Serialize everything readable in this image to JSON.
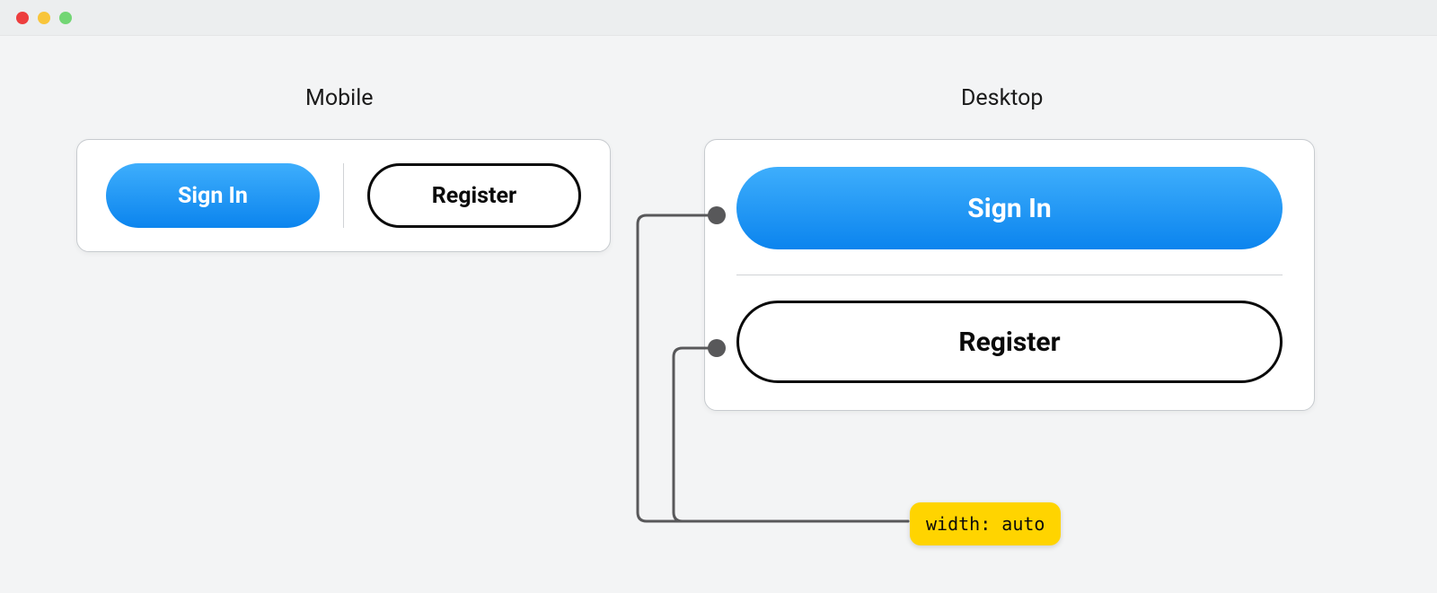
{
  "titles": {
    "mobile": "Mobile",
    "desktop": "Desktop"
  },
  "buttons": {
    "sign_in": "Sign In",
    "register": "Register"
  },
  "annotation": {
    "width_auto": "width: auto"
  }
}
